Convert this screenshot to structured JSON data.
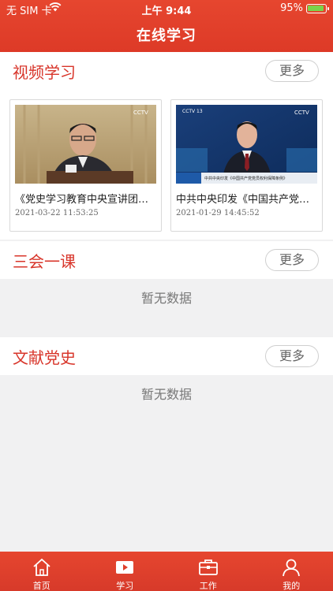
{
  "status_bar": {
    "carrier": "无 SIM 卡",
    "time": "上午 9:44",
    "battery": "95%"
  },
  "header": {
    "title": "在线学习"
  },
  "sections": [
    {
      "title": "视频学习",
      "more": "更多",
      "videos": [
        {
          "title": "《党史学习教育中央宣讲团首...",
          "time": "2021-03-22 11:53:25"
        },
        {
          "title": "中共中央印发《中国共产党党...",
          "time": "2021-01-29 14:45:52"
        }
      ]
    },
    {
      "title": "三会一课",
      "more": "更多",
      "empty": "暂无数据"
    },
    {
      "title": "文献党史",
      "more": "更多",
      "empty": "暂无数据"
    }
  ],
  "thumb_text": {
    "logo": "CCTV",
    "channel": "CCTV 13",
    "caption": "中共中央印发《中国共产党党员权利保障条例》"
  },
  "tabs": [
    {
      "label": "首页",
      "icon": "home-icon"
    },
    {
      "label": "学习",
      "icon": "video-play-icon"
    },
    {
      "label": "工作",
      "icon": "briefcase-icon"
    },
    {
      "label": "我的",
      "icon": "user-icon"
    }
  ],
  "colors": {
    "brand_red": "#e0402b",
    "title_red": "#d8352a"
  }
}
